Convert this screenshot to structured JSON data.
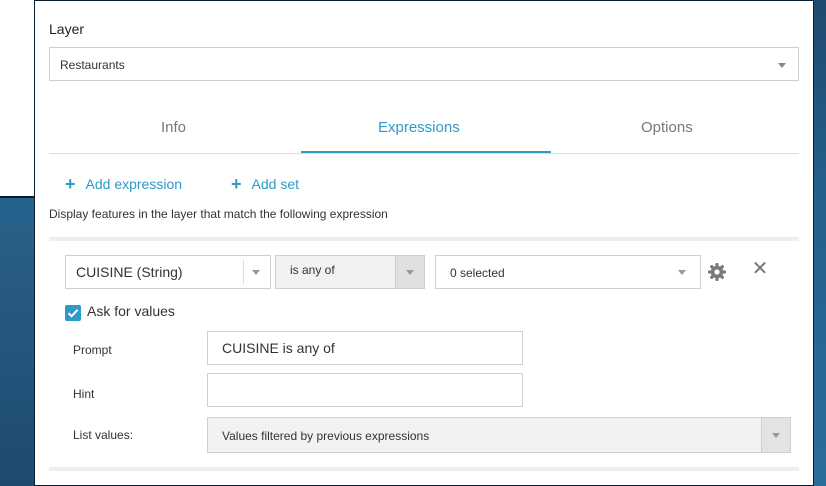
{
  "layer": {
    "label": "Layer",
    "selected": "Restaurants"
  },
  "tabs": [
    {
      "label": "Info",
      "active": false
    },
    {
      "label": "Expressions",
      "active": true
    },
    {
      "label": "Options",
      "active": false
    }
  ],
  "actions": {
    "add_expression": "Add expression",
    "add_set": "Add set"
  },
  "description": "Display features in the layer that match the following expression",
  "expression": {
    "field": "CUISINE (String)",
    "operator": "is any of",
    "value": "0 selected"
  },
  "ask_for_values": {
    "label": "Ask for values",
    "checked": true
  },
  "prompt": {
    "label": "Prompt",
    "value": "CUISINE is any of"
  },
  "hint": {
    "label": "Hint",
    "value": ""
  },
  "list_values": {
    "label": "List values:",
    "selected": "Values filtered by previous expressions"
  },
  "colors": {
    "accent": "#2d9bc7",
    "background": "#24608c"
  },
  "icons": {
    "settings": "gear-icon",
    "remove": "close-icon",
    "add": "plus-icon",
    "check": "check-icon"
  }
}
